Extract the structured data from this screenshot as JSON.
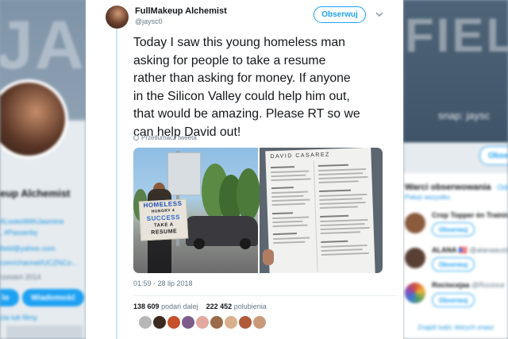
{
  "background_left": {
    "banner_text": "JASI",
    "name": "eup Alchemist",
    "links": [
      "#LooksWithJasmine",
      ", #Passerby",
      "field@yahoo.com",
      "com/channel/UCZNCo...",
      "rzesień 2014"
    ],
    "btn_primary": "lo",
    "btn_message": "Wiadomość",
    "photos_link": "cia lub filmy"
  },
  "background_right": {
    "banner_text": "FIEL",
    "snap": "snap: jaysc",
    "top_follow": "Obserwu",
    "who_to_follow": "Warci obserwowania",
    "who_to_follow_suffix": " · Odś",
    "show_all": "Pokaż wszystko",
    "suggestions": [
      {
        "name": "Crop Topper ėn Training",
        "handle": "",
        "button": "Obserwuj",
        "color": "#8a5b3d"
      },
      {
        "name": "ALANA 🇵🇷",
        "handle": "@alanaausto",
        "button": "Obserwuj",
        "color": "#5a3f34"
      },
      {
        "name": "Rociocejaa",
        "handle": "@Rocioce",
        "button": "Obserwuj",
        "color": "#d14e3b"
      }
    ],
    "find_people": "Znajdź ludzi, których znasz"
  },
  "tweet": {
    "display_name": "FullMakeup Alchemist",
    "handle": "@jaysc0",
    "follow_label": "Obserwuj",
    "caret_icon": "chevron-down-icon",
    "text": "Today I saw this young homeless man\nasking for people to take a resume\nrather than asking for money. If anyone\nin the Silicon Valley could help him out,\nthat would be amazing. Please RT so we\ncan help David out!",
    "translate": "Przetłumacz tweeta",
    "media": {
      "sign_lines": [
        "HOMELESS",
        "HUNGRY 4",
        "SUCCESS",
        "TAKE A",
        "RESUME"
      ],
      "resume_title": "DAVID CASAREZ"
    },
    "timestamp": "01:59 - 28 lip 2018",
    "retweets_count": "138 609",
    "retweets_label": "podań dalej",
    "likes_count": "222 452",
    "likes_label": "polubienia",
    "liker_colors": [
      "#b7b7b7",
      "#3a2a20",
      "#c7502d",
      "#7d5c8a",
      "#e3a8a0",
      "#9a6b4a",
      "#d9b08c",
      "#b05a3a",
      "#c99a7a"
    ]
  }
}
